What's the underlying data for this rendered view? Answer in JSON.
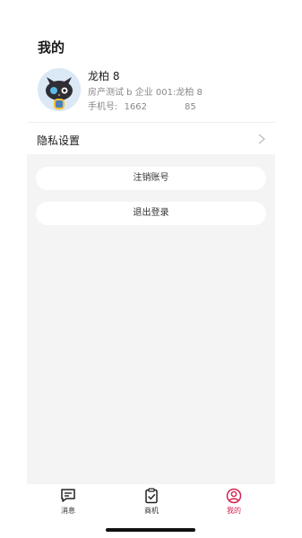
{
  "header": {
    "title": "我的"
  },
  "profile": {
    "name": "龙柏 8",
    "company": "房产测试 b 企业 001:龙柏 8",
    "phone_label": "手机号:",
    "phone_prefix": "1662",
    "phone_suffix": "85"
  },
  "settings": {
    "privacy_label": "隐私设置"
  },
  "actions": {
    "cancel_account": "注销账号",
    "logout": "退出登录"
  },
  "tabbar": {
    "items": [
      {
        "label": "消息",
        "icon": "message-icon"
      },
      {
        "label": "商机",
        "icon": "clipboard-check-icon"
      },
      {
        "label": "我的",
        "icon": "user-icon"
      }
    ],
    "active_color": "#d6204e"
  }
}
